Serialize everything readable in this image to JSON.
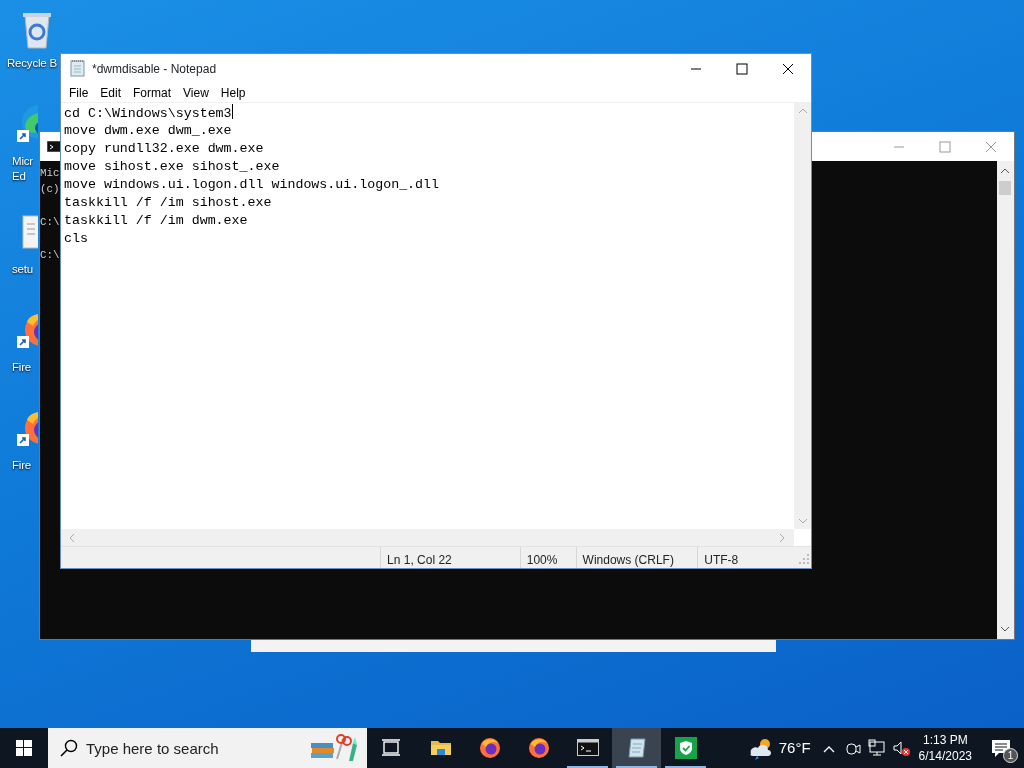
{
  "desktop_icons": [
    {
      "kind": "recycle",
      "label_lines": [
        "Recycle B"
      ]
    },
    {
      "kind": "edge",
      "label_lines": [
        "Micr",
        "Ed"
      ]
    },
    {
      "kind": "setup",
      "label_lines": [
        "setu"
      ]
    },
    {
      "kind": "firefox",
      "label_lines": [
        "Fire"
      ]
    },
    {
      "kind": "firefox",
      "label_lines": [
        "Fire"
      ]
    }
  ],
  "console_window": {
    "lines": [
      {
        "text": "Mic",
        "blank_before": false
      },
      {
        "text": "(c)",
        "blank_before": false
      },
      {
        "text": "C:\\",
        "blank_before": true
      },
      {
        "text": "C:\\",
        "blank_before": true
      }
    ]
  },
  "notepad": {
    "title": "*dwmdisable - Notepad",
    "menu": [
      "File",
      "Edit",
      "Format",
      "View",
      "Help"
    ],
    "lines": [
      "cd C:\\Windows\\system3",
      "move dwm.exe dwm_.exe",
      "copy rundll32.exe dwm.exe",
      "move sihost.exe sihost_.exe",
      "move windows.ui.logon.dll windows.ui.logon_.dll",
      "taskkill /f /im sihost.exe",
      "taskkill /f /im dwm.exe",
      "cls"
    ],
    "status_bar": [
      "Ln 1, Col 22",
      "100%",
      "Windows (CRLF)",
      "UTF-8"
    ]
  },
  "taskbar": {
    "search": {
      "placeholder": "Type here to search"
    },
    "apps": [
      {
        "kind": "taskview",
        "running": false,
        "active": false
      },
      {
        "kind": "explorer",
        "running": false,
        "active": false
      },
      {
        "kind": "firefox",
        "running": false,
        "active": false
      },
      {
        "kind": "firefox",
        "running": false,
        "active": false
      },
      {
        "kind": "console",
        "running": true,
        "active": false
      },
      {
        "kind": "notepad",
        "running": true,
        "active": true
      },
      {
        "kind": "defender",
        "running": true,
        "active": false
      }
    ],
    "weather": {
      "temperature": "76°F"
    },
    "clock": {
      "time": "1:13 PM",
      "date": "6/14/2023"
    },
    "notifications": {
      "count": "1"
    }
  }
}
